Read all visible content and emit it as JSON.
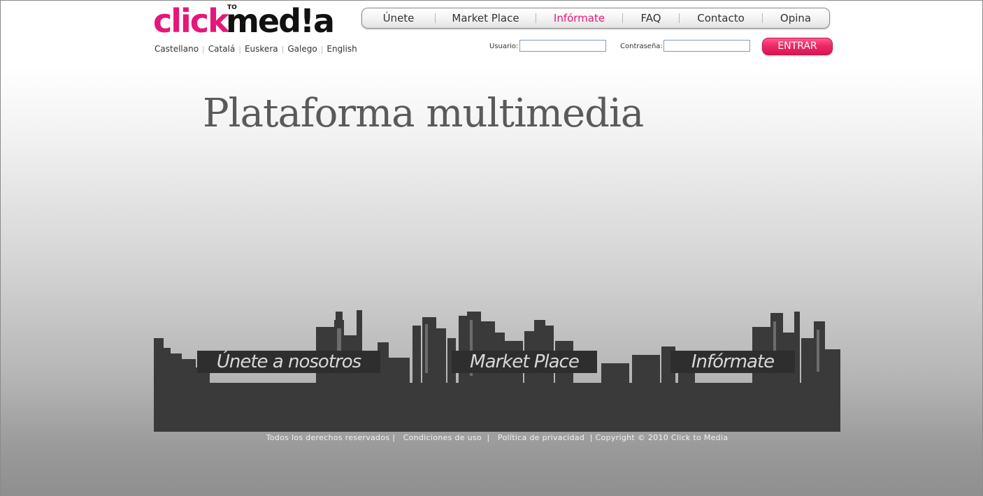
{
  "logo": {
    "part_a": "click",
    "part_sup": "TO",
    "part_b": "med!a"
  },
  "languages": [
    "Castellano",
    "Catalá",
    "Euskera",
    "Galego",
    "English"
  ],
  "nav": [
    {
      "label": "Únete",
      "active": false
    },
    {
      "label": "Market Place",
      "active": false
    },
    {
      "label": "Infórmate",
      "active": true
    },
    {
      "label": "FAQ",
      "active": false
    },
    {
      "label": "Contacto",
      "active": false
    },
    {
      "label": "Opina",
      "active": false
    }
  ],
  "login": {
    "user_label": "Usuario:",
    "user_value": "",
    "password_label": "Contraseña:",
    "password_value": "",
    "submit_label": "ENTRAR"
  },
  "headline": "Plataforma multimedia",
  "ctas": [
    "Únete a nosotros",
    "Market Place",
    "Infórmate"
  ],
  "footer": {
    "rights": "Todos los derechos reservados",
    "terms": "Condiciones de uso",
    "privacy": "Política de privacidad",
    "copyright": "Copyright © 2010 Click to Media"
  },
  "colors": {
    "brand": "#e6167a",
    "skyline": "#3a3a3a",
    "cta_bg": "#2e2e2e"
  }
}
